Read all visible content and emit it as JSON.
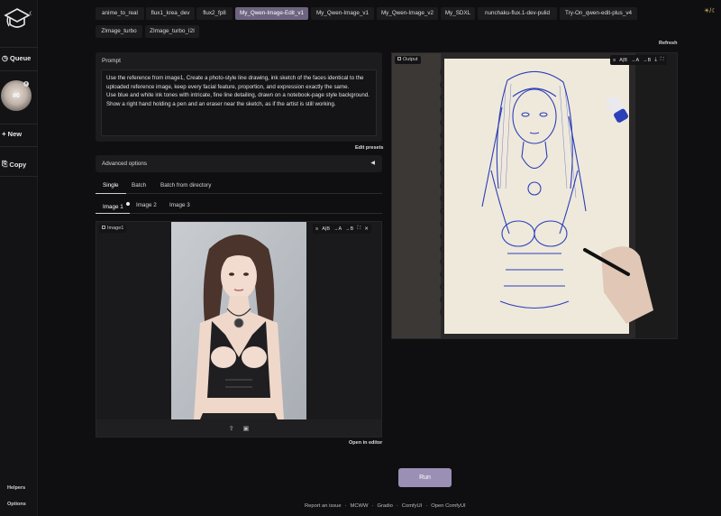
{
  "sidebar": {
    "queue_label": "Queue",
    "queue_badge": "#0",
    "new_label": "New",
    "copy_label": "Copy",
    "helpers_label": "Helpers",
    "options_label": "Options"
  },
  "model_tabs": [
    {
      "label": "anime_to_real",
      "active": false
    },
    {
      "label": "flux1_krea_dev",
      "active": false
    },
    {
      "label": "flux2_fp8",
      "active": false
    },
    {
      "label": "My_Qwen-Image-Edit_v1",
      "active": true
    },
    {
      "label": "My_Qwen-Image_v1",
      "active": false
    },
    {
      "label": "My_Qwen-Image_v2",
      "active": false
    },
    {
      "label": "My_SDXL",
      "active": false
    },
    {
      "label": "nunchaku-flux.1-dev-pulid",
      "active": false
    },
    {
      "label": "Try-On_qwen-edit-plus_v4",
      "active": false
    },
    {
      "label": "ZImage_turbo",
      "active": false
    },
    {
      "label": "ZImage_turbo_I2I",
      "active": false
    }
  ],
  "refresh_label": "Refresh",
  "prompt": {
    "label": "Prompt",
    "value": "Use the reference from image1, Create a photo-style line drawing, ink sketch of the faces identical to the uploaded reference image, keep every facial feature, proportion, and expression exactly the same.\nUse blue and white ink tones with intricate, fine line detailing, drawn on a notebook-page style background.\nShow a right hand holding a pen and an eraser near the sketch, as if the artist is still working.",
    "edit_presets_label": "Edit presets"
  },
  "advanced_options_label": "Advanced options",
  "mode_tabs": [
    {
      "label": "Single",
      "active": true
    },
    {
      "label": "Batch",
      "active": false
    },
    {
      "label": "Batch from directory",
      "active": false
    }
  ],
  "image_tabs": [
    {
      "label": "Image 1",
      "active": true
    },
    {
      "label": "Image 2",
      "active": false
    },
    {
      "label": "Image 3",
      "active": false
    }
  ],
  "image_panel": {
    "tag": "Image1",
    "open_editor_label": "Open in editor"
  },
  "output_panel": {
    "tag": "Output"
  },
  "toolbar_labels": {
    "compare": "A|B",
    "to_a": "→A",
    "to_b": "→B"
  },
  "run_label": "Run",
  "footer": {
    "links": [
      "Report an issue",
      "MCWW",
      "Gradio",
      "ComfyUI",
      "Open ComfyUI"
    ]
  },
  "colors": {
    "accent": "#6e6480",
    "run_button": "#9b8fb5",
    "background": "#0f0f11",
    "panel": "#1c1c1f",
    "ink_blue": "#2b3fb8"
  }
}
